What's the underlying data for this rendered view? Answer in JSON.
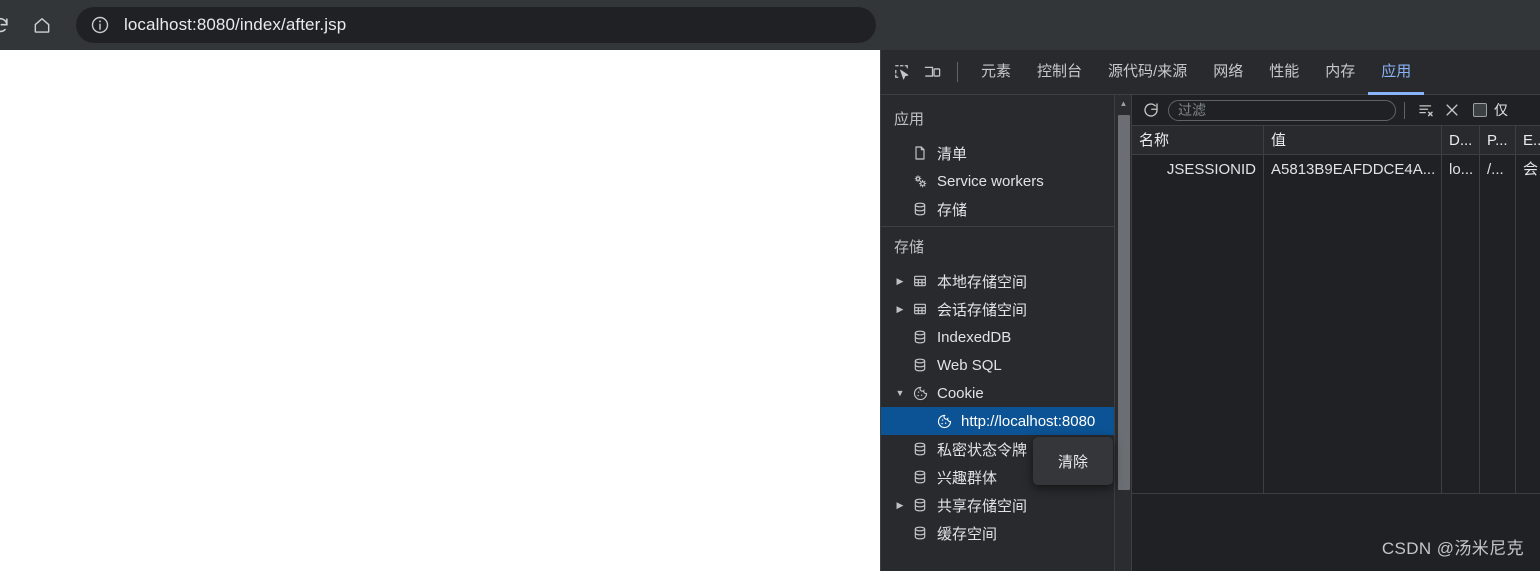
{
  "browser": {
    "reload_icon": "reload-icon",
    "home_icon": "home-icon",
    "info_icon": "site-info-icon",
    "url": "localhost:8080/index/after.jsp"
  },
  "devtools": {
    "inspect_icon": "inspect-element-icon",
    "device_icon": "device-toolbar-icon",
    "tabs": [
      {
        "label": "元素",
        "active": false
      },
      {
        "label": "控制台",
        "active": false
      },
      {
        "label": "源代码/来源",
        "active": false
      },
      {
        "label": "网络",
        "active": false
      },
      {
        "label": "性能",
        "active": false
      },
      {
        "label": "内存",
        "active": false
      },
      {
        "label": "应用",
        "active": true
      }
    ],
    "sidebar": {
      "sections": [
        {
          "title": "应用",
          "items": [
            {
              "label": "清单",
              "icon": "manifest-document-icon",
              "twisty": "",
              "level": 1,
              "selected": false
            },
            {
              "label": "Service workers",
              "icon": "service-worker-gears-icon",
              "twisty": "",
              "level": 1,
              "selected": false
            },
            {
              "label": "存储",
              "icon": "storage-database-icon",
              "twisty": "",
              "level": 1,
              "selected": false
            }
          ]
        },
        {
          "title": "存储",
          "items": [
            {
              "label": "本地存储空间",
              "icon": "table-icon",
              "twisty": "collapsed",
              "level": 1,
              "selected": false
            },
            {
              "label": "会话存储空间",
              "icon": "table-icon",
              "twisty": "collapsed",
              "level": 1,
              "selected": false
            },
            {
              "label": "IndexedDB",
              "icon": "database-icon",
              "twisty": "",
              "level": 1,
              "selected": false
            },
            {
              "label": "Web SQL",
              "icon": "database-icon",
              "twisty": "",
              "level": 1,
              "selected": false
            },
            {
              "label": "Cookie",
              "icon": "cookie-icon",
              "twisty": "expanded",
              "level": 1,
              "selected": false
            },
            {
              "label": "http://localhost:8080",
              "icon": "cookie-icon",
              "twisty": "",
              "level": 2,
              "selected": true
            },
            {
              "label": "私密状态令牌",
              "icon": "database-icon",
              "twisty": "",
              "level": 1,
              "selected": false
            },
            {
              "label": "兴趣群体",
              "icon": "database-icon",
              "twisty": "",
              "level": 1,
              "selected": false
            },
            {
              "label": "共享存储空间",
              "icon": "database-icon",
              "twisty": "collapsed",
              "level": 1,
              "selected": false
            },
            {
              "label": "缓存空间",
              "icon": "database-icon",
              "twisty": "",
              "level": 1,
              "selected": false
            }
          ]
        }
      ],
      "scrollbar": {
        "up_arrow_icon": "scroll-up-arrow-icon"
      }
    },
    "cookie_panel": {
      "toolbar": {
        "refresh_icon": "refresh-icon",
        "filter_placeholder": "过滤",
        "filter_value": "",
        "clear_filtered_icon": "clear-filtered-cookies-icon",
        "clear_all_icon": "clear-all-cookies-icon",
        "only_checkbox_label": "仅",
        "only_checkbox_checked": false
      },
      "columns": [
        "名称",
        "值",
        "D...",
        "P...",
        "E..."
      ],
      "rows": [
        {
          "name": "JSESSIONID",
          "value": "A5813B9EAFDDCE4A...",
          "domain": "lo...",
          "path": "/...",
          "expires": "会"
        }
      ]
    },
    "context_menu": {
      "items": [
        "清除"
      ]
    }
  },
  "watermark": "CSDN @汤米尼克",
  "colors": {
    "accent": "#8ab4f8",
    "selection": "#0b5394",
    "chrome_bar": "#323639",
    "omnibox": "#202124",
    "devtools_bg": "#202124",
    "devtools_panel": "#292a2d"
  }
}
